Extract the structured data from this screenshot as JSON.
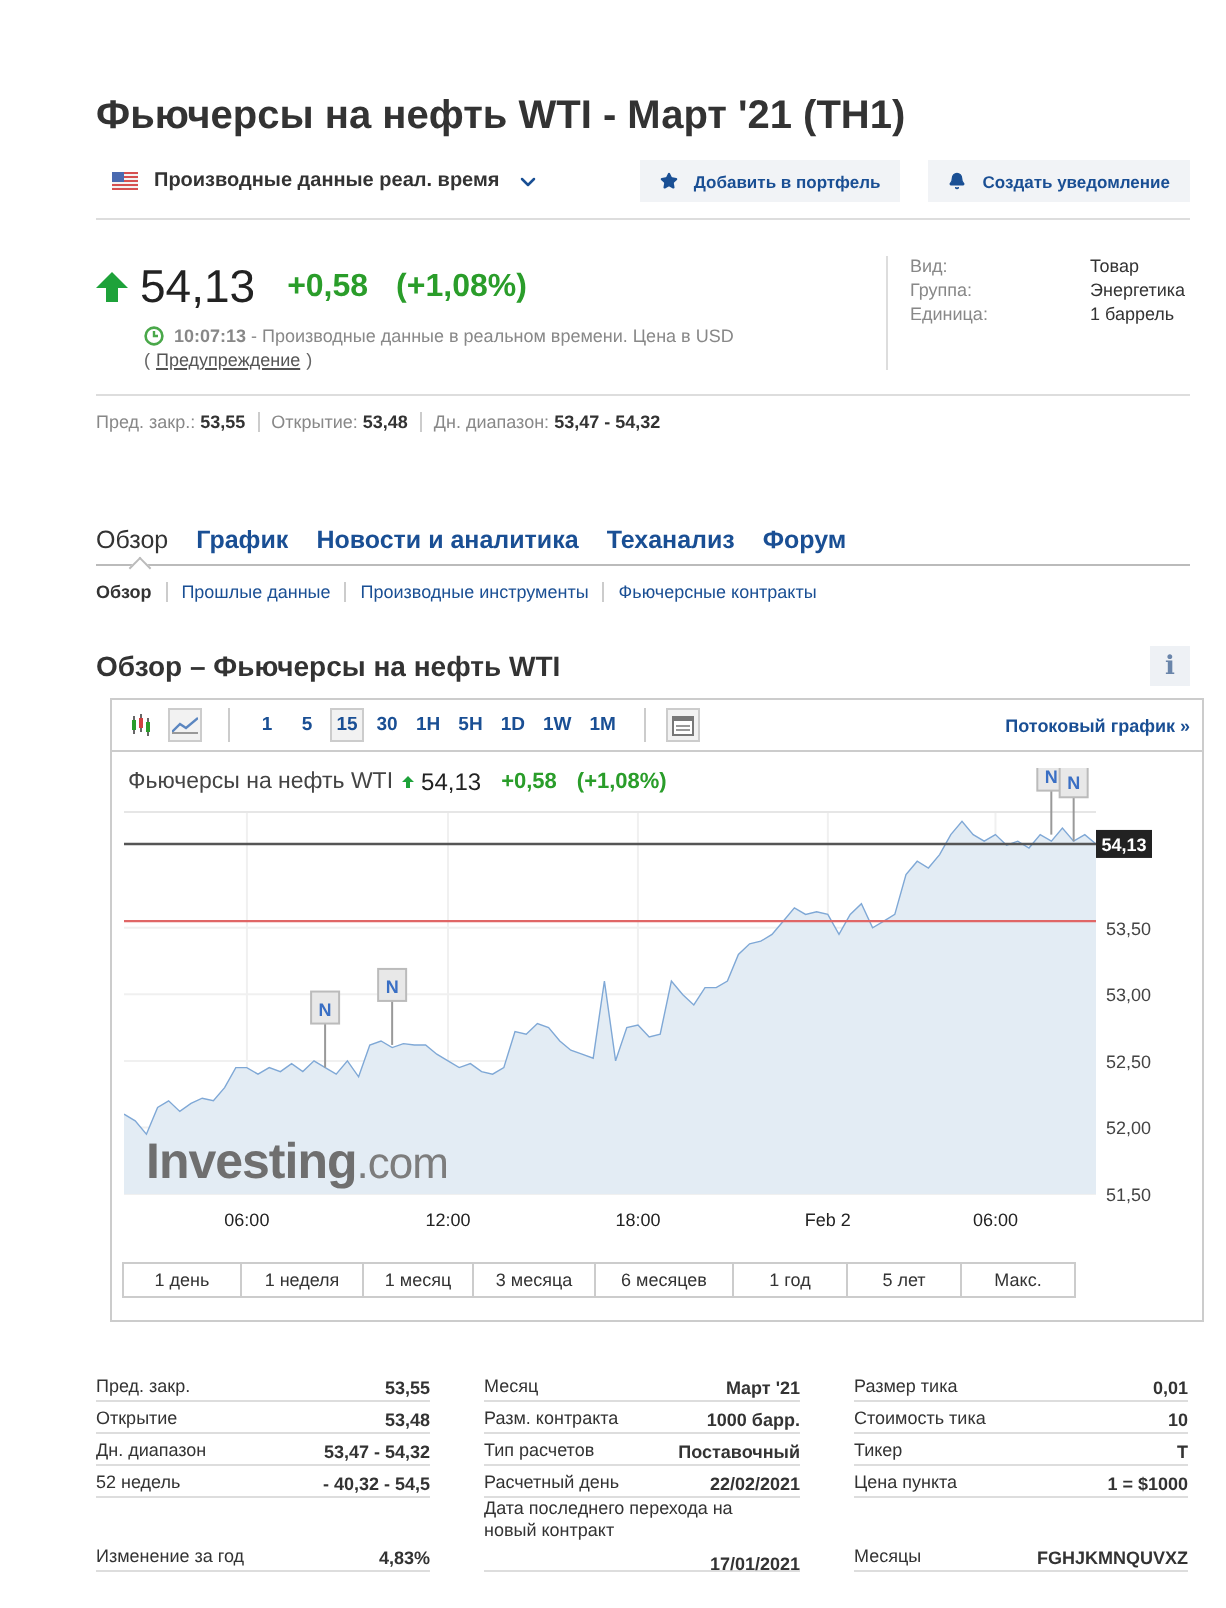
{
  "title": "Фьючерсы на нефть WTI - Март '21 (TH1)",
  "data_source": {
    "label": "Производные данные реал. время"
  },
  "actions": [
    {
      "kind": "portfolio",
      "label": "Добавить в портфель"
    },
    {
      "kind": "alert",
      "label": "Создать уведомление"
    }
  ],
  "quote": {
    "price": "54,13",
    "change": "+0,58",
    "change_pct": "(+1,08%)",
    "time": "10:07:13",
    "time_note": " - Производные данные в реальном времени. Цена в USD",
    "disclaimer_open": "(",
    "disclaimer_link": "Предупреждение",
    "disclaimer_close": ")"
  },
  "info": [
    {
      "label": "Вид:",
      "value": "Товар"
    },
    {
      "label": "Группа:",
      "value": "Энергетика"
    },
    {
      "label": "Единица:",
      "value": "1 баррель"
    }
  ],
  "summary": [
    {
      "label": "Пред. закр.:",
      "value": "53,55"
    },
    {
      "label": "Открытие:",
      "value": "53,48"
    },
    {
      "label": "Дн. диапазон:",
      "value": "53,47 - 54,32"
    }
  ],
  "tabs": [
    {
      "label": "Обзор",
      "selected": true
    },
    {
      "label": "График",
      "selected": false
    },
    {
      "label": "Новости и аналитика",
      "selected": false
    },
    {
      "label": "Теханализ",
      "selected": false
    },
    {
      "label": "Форум",
      "selected": false
    }
  ],
  "subtabs": [
    {
      "label": "Обзор",
      "selected": true
    },
    {
      "label": "Прошлые данные",
      "selected": false
    },
    {
      "label": "Производные инструменты",
      "selected": false
    },
    {
      "label": "Фьючерсные контракты",
      "selected": false
    }
  ],
  "section": {
    "title": "Обзор – Фьючерсы на нефть WTI",
    "info_button": "i"
  },
  "chart": {
    "chart_types": [
      {
        "kind": "candles",
        "selected": false
      },
      {
        "kind": "line",
        "selected": true
      }
    ],
    "intervals": [
      {
        "label": "1",
        "selected": false
      },
      {
        "label": "5",
        "selected": false
      },
      {
        "label": "15",
        "selected": true
      },
      {
        "label": "30",
        "selected": false
      },
      {
        "label": "1H",
        "selected": false
      },
      {
        "label": "5H",
        "selected": false
      },
      {
        "label": "1D",
        "selected": false
      },
      {
        "label": "1W",
        "selected": false
      },
      {
        "label": "1M",
        "selected": false
      }
    ],
    "stream_link": "Потоковый график »",
    "legend": {
      "price": "54,13",
      "change": "+0,58",
      "change_pct": "(+1,08%)"
    },
    "brand_mark": "**Investing**.com",
    "chart_data": {
      "type": "area",
      "categories": [
        null,
        null,
        null,
        null,
        null,
        null,
        null,
        null,
        null,
        null,
        null,
        "06:00",
        null,
        null,
        null,
        null,
        null,
        null,
        null,
        null,
        null,
        null,
        null,
        null,
        null,
        null,
        null,
        null,
        null,
        "12:00",
        null,
        null,
        null,
        null,
        null,
        null,
        null,
        null,
        null,
        null,
        null,
        null,
        null,
        null,
        null,
        null,
        "18:00",
        null,
        null,
        null,
        null,
        null,
        null,
        null,
        null,
        null,
        null,
        null,
        null,
        null,
        null,
        null,
        null,
        "Feb 2",
        null,
        null,
        null,
        null,
        null,
        null,
        null,
        null,
        null,
        null,
        null,
        null,
        null,
        null,
        "06:00",
        null,
        null,
        null,
        null,
        null,
        null,
        null,
        null,
        null
      ],
      "series": [
        {
          "name": "Фьючерсы на нефть WTI",
          "color": "#7fa8d6",
          "values": [
            52.1,
            52.05,
            51.95,
            52.15,
            52.2,
            52.12,
            52.18,
            52.22,
            52.2,
            52.3,
            52.45,
            52.45,
            52.4,
            52.45,
            52.42,
            52.48,
            52.42,
            52.5,
            52.45,
            52.4,
            52.5,
            52.38,
            52.62,
            52.65,
            52.6,
            52.63,
            52.62,
            52.62,
            52.55,
            52.5,
            52.45,
            52.48,
            52.42,
            52.4,
            52.45,
            52.72,
            52.7,
            52.78,
            52.75,
            52.65,
            52.58,
            52.55,
            52.52,
            53.1,
            52.5,
            52.75,
            52.77,
            52.68,
            52.7,
            53.1,
            53.0,
            52.92,
            53.05,
            53.05,
            53.1,
            53.3,
            53.38,
            53.4,
            53.45,
            53.55,
            53.65,
            53.6,
            53.62,
            53.6,
            53.45,
            53.6,
            53.68,
            53.5,
            53.55,
            53.6,
            53.9,
            54.0,
            53.95,
            54.05,
            54.2,
            54.3,
            54.2,
            54.15,
            54.2,
            54.12,
            54.15,
            54.1,
            54.2,
            54.15,
            54.25,
            54.15,
            54.2,
            54.13
          ]
        }
      ],
      "ylim": [
        51.5,
        54.37
      ],
      "grid": true,
      "yticks": [
        {
          "value": 51.5,
          "label": "51,50"
        },
        {
          "value": 52,
          "label": "52,00"
        },
        {
          "value": 52.5,
          "label": "52,50"
        },
        {
          "value": 53,
          "label": "53,00"
        },
        {
          "value": 53.5,
          "label": "53,50"
        }
      ],
      "ref_lines": [
        {
          "axis": "y",
          "value": 53.55
        },
        {
          "axis": "y",
          "value": 54.13,
          "label": "54,13"
        }
      ]
    },
    "news_flags": [
      {
        "label": "N"
      },
      {
        "label": "N"
      },
      {
        "label": "N"
      },
      {
        "label": "N"
      }
    ],
    "ranges": [
      {
        "label": "1 день",
        "selected": false
      },
      {
        "label": "1 неделя",
        "selected": false
      },
      {
        "label": "1 месяц",
        "selected": false
      },
      {
        "label": "3 месяца",
        "selected": false
      },
      {
        "label": "6 месяцев",
        "selected": false
      },
      {
        "label": "1 год",
        "selected": false
      },
      {
        "label": "5 лет",
        "selected": false
      },
      {
        "label": "Макс.",
        "selected": false
      }
    ]
  },
  "stats": [
    [
      {
        "label": "Пред. закр.",
        "value": "53,55"
      },
      {
        "label": "Открытие",
        "value": "53,48"
      },
      {
        "label": "Дн. диапазон",
        "value": "53,47 - 54,32"
      },
      {
        "label": "52 недель",
        "value": "- 40,32 - 54,5"
      },
      {
        "label": "Изменение за год",
        "value": "4,83%"
      }
    ],
    [
      {
        "label": "Месяц",
        "value": "Март '21"
      },
      {
        "label": "Разм. контракта",
        "value": "1000 барр."
      },
      {
        "label": "Тип расчетов",
        "value": "Поставочный"
      },
      {
        "label": "Расчетный день",
        "value": "22/02/2021"
      },
      {
        "label": "Дата последнего перехода на новый контракт",
        "value": "17/01/2021"
      }
    ],
    [
      {
        "label": "Размер тика",
        "value": "0,01"
      },
      {
        "label": "Стоимость тика",
        "value": "10"
      },
      {
        "label": "Тикер",
        "value": "T"
      },
      {
        "label": "Цена пункта",
        "value": "1 = $1000"
      },
      {
        "label": "Месяцы",
        "value": "FGHJKMNQUVXZ"
      }
    ]
  ]
}
